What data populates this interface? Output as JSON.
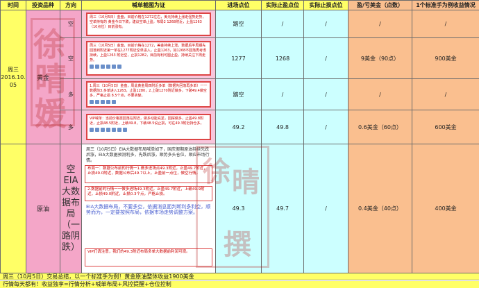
{
  "header": {
    "time": "时间",
    "variety": "投资品种",
    "direction": "方向",
    "proof": "喊单截图为证",
    "entry": "进场点位",
    "take_profit": "实际止盈点位",
    "stop_loss": "实际止损点位",
    "pnl": "盈/亏美金（点数）",
    "standard": "1个标准手为例收益情况"
  },
  "date": "周三\n2016.10.\n05",
  "gold": {
    "variety": "黄金",
    "rows": [
      {
        "direction": "空",
        "entry": "踏空",
        "tp": "/",
        "sl": "/",
        "pnl": "/",
        "std": "/",
        "shot": "周三（10月5日）金盘，目前价格在1272左右，美元持续上涨走强势走势，空单持有的 黄金今日下跌，建议空单止盈，布局2 1268附近，止盈1263（10点位）目前涨有。"
      },
      {
        "direction": "空",
        "entry": "1277",
        "tp": "1268",
        "sl": "/",
        "pnl": "9美金（90点）",
        "std": "900美金",
        "shot": "周三（10月5日）金盘，目前价格在1272，美金持续上涨，数据后半周期先回落到附近第一单在1277附近空单进入，止盈1263，如1268不回落再考虑持续，上盈1263 附近空，止损1282，目前有利可图止盈，持续关注下周走势。"
      },
      {
        "direction": "多",
        "entry": "踏空",
        "tp": "/",
        "sl": "/",
        "pnl": "/",
        "std": "/",
        "shot": "1.周三（10月5日）金盘，周此黄金周四附近多单（数据先回落再多单）一一数据前3.多单进入1263，止盈1280，2.上破1270附近做多，下破49.4做空多，严格止损 8.5个点，不要贪婪。"
      },
      {
        "direction": "多",
        "entry": "49.2",
        "tp": "49.8",
        "sl": "/",
        "pnl": "0.6美金（60点）",
        "std": "600美金",
        "shot": "VIP喊单：当前价格需回落在附近，做多动能充足，回踩做多，止盈49.8附近，止损48.5附近，上破49.8，下破48.5设止损，可在49.3附近持仓多。"
      }
    ]
  },
  "crude": {
    "variety": "原油",
    "direction_label": "空\nEIA大数据布局（一路阴跌）",
    "entry": "49.3",
    "tp": "49.7",
    "sl": "/",
    "pnl": "0.4美金（40点）",
    "std": "400美金",
    "notes": [
      "周三（10月5日）EIA大数据布局喊单如下，国庆假期原油持续先跌后涨，EIA大数据预测利多，先跌后涨，顺势多头仓位，顺应市场行情。",
      "布局一：数据公布前的行情一1.做多进场点49.3附近，止盈49.7附近，止损49.0附近，数据公布后49.7以上，止盈前一点位，做空行情。",
      "2.数据前的行情一一做多进场49.3附近，止盈49.7附近，上破49.9附近，止损49.0附近，止损0.3个点，严格止损。",
      "EIA大数据布局，不要多空，依据消息面判断利多利空，顺势而为，一定要按照布局，依据市场走势调整方案。",
      "VIP们请注意，我们的49.3附近布局多单大数据前利润可观。"
    ]
  },
  "footer": {
    "summary": "周三（10月5日）交易总结，以一个标准手为例！黄金原油整体收益1900美金",
    "slogan": "行情每天都有！收益独享=行情分析+喊单布局+风控提醒+仓位控制"
  },
  "watermark": [
    "徐",
    "晴",
    "媛",
    "徐",
    "晴",
    "撰"
  ],
  "colors": {
    "yellow": "#ffff66",
    "pink": "#f4a6c8",
    "cyan": "#ccffff",
    "orange": "#fabf8f"
  }
}
